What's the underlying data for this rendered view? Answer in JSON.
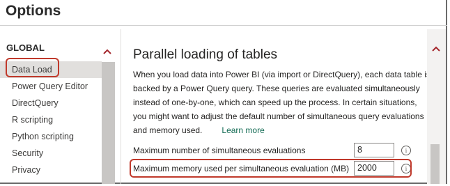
{
  "window": {
    "title": "Options"
  },
  "sidebar": {
    "group": "GLOBAL",
    "items": [
      {
        "label": "Data Load"
      },
      {
        "label": "Power Query Editor"
      },
      {
        "label": "DirectQuery"
      },
      {
        "label": "R scripting"
      },
      {
        "label": "Python scripting"
      },
      {
        "label": "Security"
      },
      {
        "label": "Privacy"
      }
    ]
  },
  "section": {
    "heading": "Parallel loading of tables",
    "description": "When you load data into Power BI (via import or DirectQuery), each data table is backed by a Power Query query. These queries are evaluated simultaneously instead of one-by-one, which can speed up the process. In certain situations, you might want to adjust the default number of simultaneous query evaluations and memory used.",
    "learn_more": "Learn more",
    "max_evaluations_label": "Maximum number of simultaneous evaluations",
    "max_evaluations_value": "8",
    "max_memory_label": "Maximum memory used per simultaneous evaluation (MB)",
    "max_memory_value": "2000"
  },
  "colors": {
    "highlight": "#c0392b",
    "link": "#136b54",
    "selected_bg": "#e1dfdd"
  }
}
